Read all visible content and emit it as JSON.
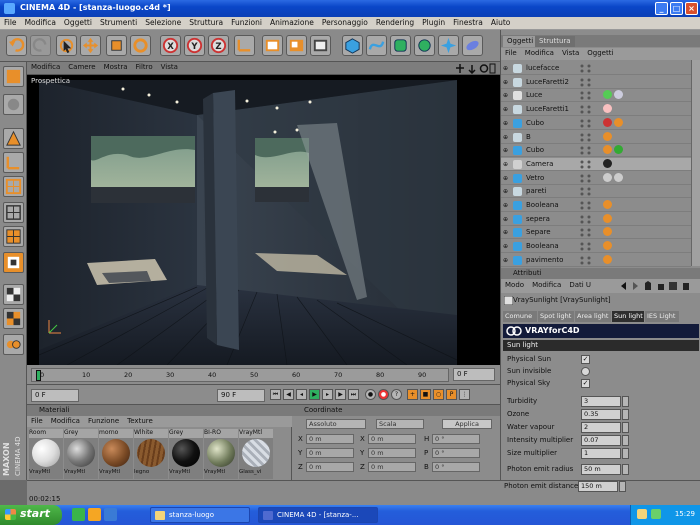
{
  "window": {
    "title": "CINEMA 4D - [stanza-luogo.c4d *]"
  },
  "menubar": [
    "File",
    "Modifica",
    "Oggetti",
    "Strumenti",
    "Selezione",
    "Struttura",
    "Funzioni",
    "Animazione",
    "Personaggio",
    "Rendering",
    "Plugin",
    "Finestra",
    "Aiuto"
  ],
  "viewport": {
    "menu": [
      "Modifica",
      "Camere",
      "Mostra",
      "Filtro",
      "Vista"
    ],
    "label": "Prospettica"
  },
  "timeline": {
    "ticks": [
      "0",
      "10",
      "20",
      "30",
      "40",
      "50",
      "60",
      "70",
      "80",
      "90"
    ],
    "current_frame": "0 F",
    "start_field": "0 F",
    "end_field": "90 F"
  },
  "materials": {
    "header": "Materiali",
    "menu": [
      "File",
      "Modifica",
      "Funzione",
      "Texture"
    ],
    "items": [
      {
        "name": "Room",
        "tag": "VrayMtl",
        "color": "#f2f2f2"
      },
      {
        "name": "Grey",
        "tag": "VrayMtl",
        "color": "#7d7d7d"
      },
      {
        "name": "morno",
        "tag": "VrayMtl",
        "color": "#7a4a25"
      },
      {
        "name": "Wlhite",
        "tag": "legno",
        "color": "#8a5a2e"
      },
      {
        "name": "Grey",
        "tag": "VrayMtl",
        "color": "#101010"
      },
      {
        "name": "BI-RO",
        "tag": "VrayMtl",
        "color": "#6f7a5a"
      },
      {
        "name": "VrayMtl",
        "tag": "Glass_vi",
        "color": "#c4c9d0"
      }
    ]
  },
  "coordinates": {
    "header": "Coordinate",
    "rows": [
      {
        "axis": "X",
        "pos": "0 m",
        "size": "0 m",
        "rot_label": "H",
        "rot": "0 °"
      },
      {
        "axis": "Y",
        "pos": "0 m",
        "size": "0 m",
        "rot_label": "P",
        "rot": "0 °"
      },
      {
        "axis": "Z",
        "pos": "0 m",
        "size": "0 m",
        "rot_label": "B",
        "rot": "0 °"
      }
    ],
    "mode": "Assoluto",
    "scale": "Scala",
    "apply": "Applica"
  },
  "objects": {
    "tabs": [
      "Oggetti",
      "Struttura"
    ],
    "menu": [
      "File",
      "Modifica",
      "Vista",
      "Oggetti"
    ],
    "rows": [
      {
        "name": "lucefacce",
        "icon": "#c8d8e0"
      },
      {
        "name": "LuceFaretti2",
        "icon": "#c8d8e0"
      },
      {
        "name": "Luce",
        "icon": "#e0e0e0"
      },
      {
        "name": "LuceFaretti1",
        "icon": "#c8d8e0"
      },
      {
        "name": "Cubo",
        "icon": "#3aa0e0"
      },
      {
        "name": "B",
        "icon": "#c8d8e0"
      },
      {
        "name": "Cubo",
        "icon": "#3aa0e0"
      },
      {
        "name": "Camera",
        "icon": "#d0d0d0"
      },
      {
        "name": "Vetro",
        "icon": "#3aa0e0"
      },
      {
        "name": "pareti",
        "icon": "#c8d8e0"
      },
      {
        "name": "Booleana",
        "icon": "#3aa0e0"
      },
      {
        "name": "sepera",
        "icon": "#3aa0e0"
      },
      {
        "name": "Separe",
        "icon": "#3aa0e0"
      },
      {
        "name": "Booleana",
        "icon": "#3aa0e0"
      },
      {
        "name": "pavimento",
        "icon": "#3aa0e0"
      }
    ]
  },
  "attributes": {
    "title": "Attributi",
    "menu": [
      "Modo",
      "Modifica",
      "Dati U"
    ],
    "object": "VraySunlight [VraySunlight]",
    "tabs": [
      "Comune",
      "Spot light",
      "Area light",
      "Sun light",
      "IES Light"
    ],
    "active_tab": "Sun light",
    "brand": "VRAYforC4D",
    "section": "Sun light",
    "checks": [
      {
        "label": "Physical Sun",
        "checked": "✓"
      },
      {
        "label": "Sun invisible",
        "checked": ""
      },
      {
        "label": "Physical Sky",
        "checked": "✓"
      }
    ],
    "values": [
      {
        "label": "Turbidity",
        "value": "3"
      },
      {
        "label": "Ozone",
        "value": "0.35"
      },
      {
        "label": "Water vapour",
        "value": "2"
      },
      {
        "label": "Intensity multiplier",
        "value": "0.07"
      },
      {
        "label": "Size multiplier",
        "value": "1"
      }
    ],
    "photon": [
      {
        "label": "Photon emit radius",
        "value": "50 m"
      },
      {
        "label": "Photon emit distance",
        "value": "150 m"
      }
    ]
  },
  "status": {
    "time": "00:02:15"
  },
  "taskbar": {
    "start": "start",
    "tasks": [
      {
        "label": "stanza-luogo",
        "active": false
      },
      {
        "label": "CINEMA 4D - [stanza-...",
        "active": true
      }
    ],
    "clock": "15:29"
  },
  "colors": {
    "accent": "#e88f2a",
    "titlebar": "#0a46c8",
    "viewport_bg": "#1c2026"
  }
}
